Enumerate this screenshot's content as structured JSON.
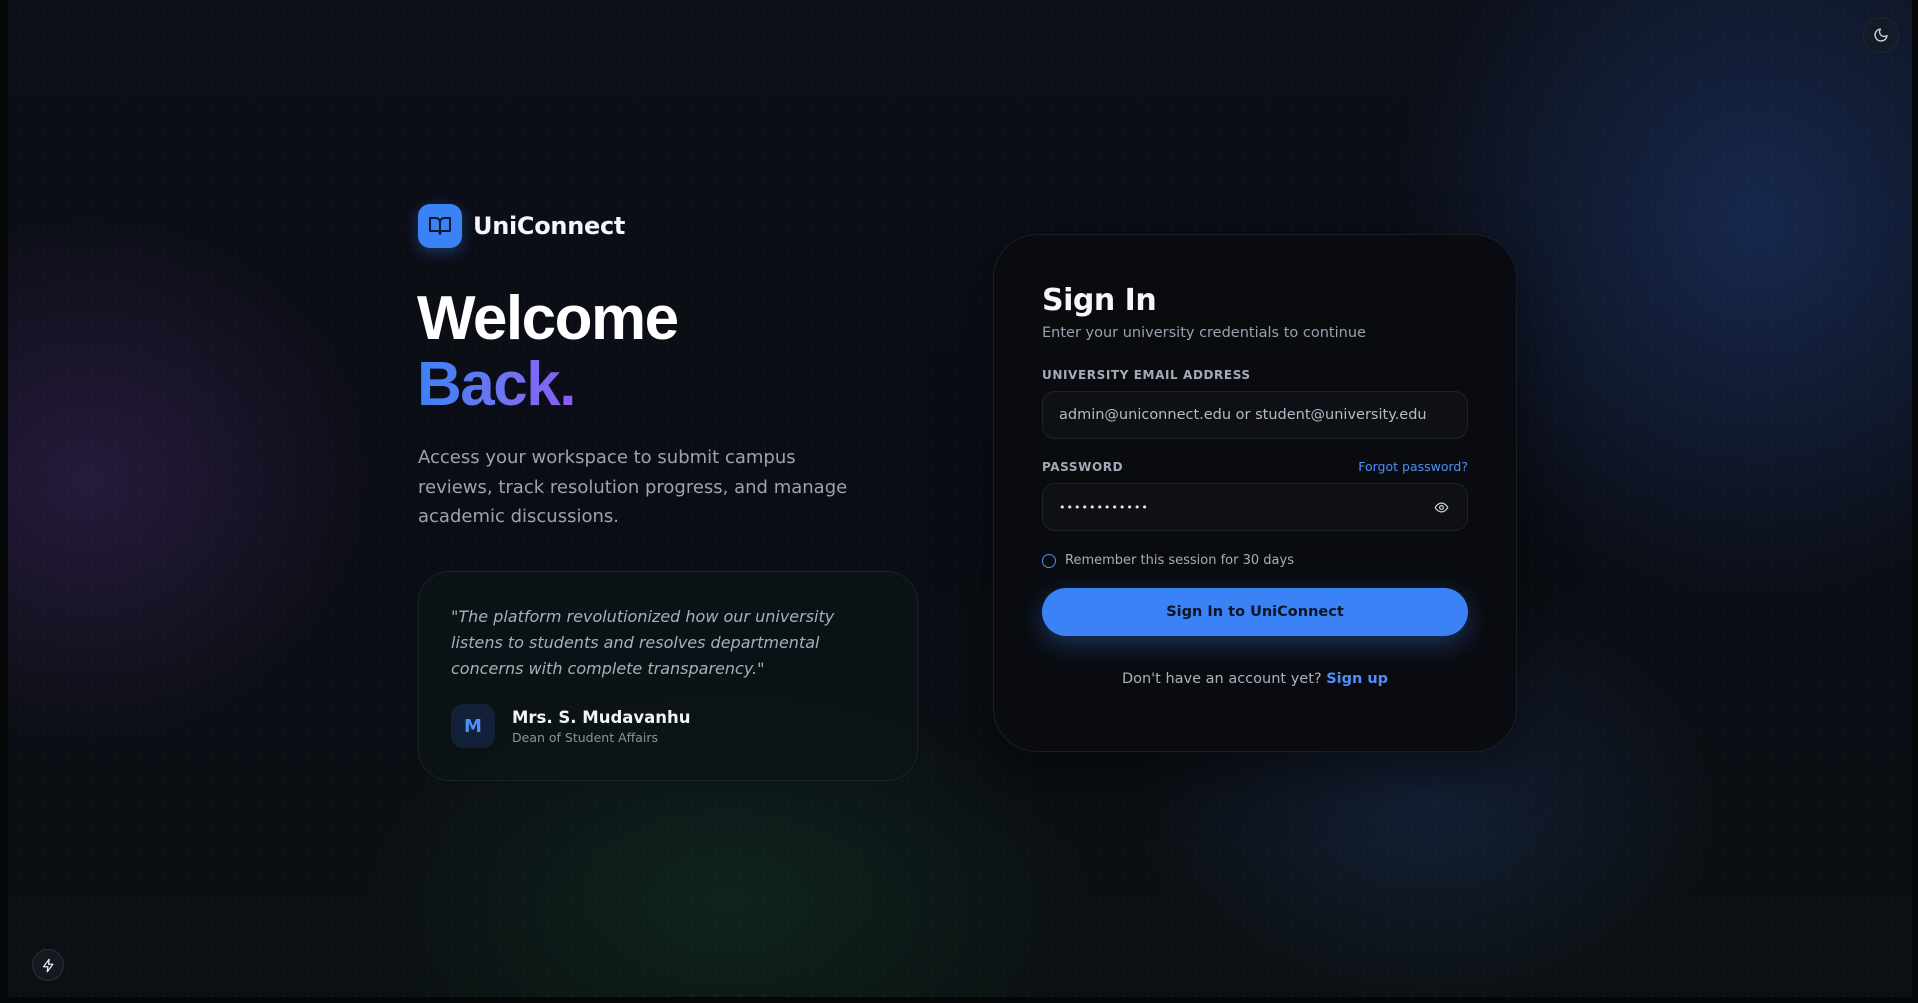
{
  "theme_toggle": {
    "icon": "moon-icon"
  },
  "corner_button": {
    "icon": "bolt-icon"
  },
  "brand": {
    "icon": "book-open-icon",
    "name": "UniConnect",
    "accent": "#3b82f6"
  },
  "hero": {
    "title_line1": "Welcome",
    "title_line2": "Back.",
    "description": "Access your workspace to submit campus reviews, track resolution progress, and manage academic discussions."
  },
  "testimonial": {
    "quote": "\"The platform revolutionized how our university listens to students and resolves departmental concerns with complete transparency.\"",
    "avatar_initial": "M",
    "author_name": "Mrs. S. Mudavanhu",
    "author_role": "Dean of Student Affairs"
  },
  "signin": {
    "title": "Sign In",
    "subtitle": "Enter your university credentials to continue",
    "email": {
      "label": "University Email Address",
      "placeholder": "admin@uniconnect.edu or student@university.edu",
      "value": ""
    },
    "password": {
      "label": "Password",
      "masked_value": "••••••••••••",
      "forgot_label": "Forgot password?",
      "toggle_icon": "eye-icon"
    },
    "remember_label": "Remember this session for 30 days",
    "remember_checked": false,
    "submit_label": "Sign In to UniConnect",
    "signup_prompt": "Don't have an account yet?",
    "signup_link": "Sign up"
  },
  "colors": {
    "background": "#0a0c12",
    "primary": "#3b82f6",
    "gradient_end": "#8b5cf6",
    "card": "#0a0b0f"
  }
}
